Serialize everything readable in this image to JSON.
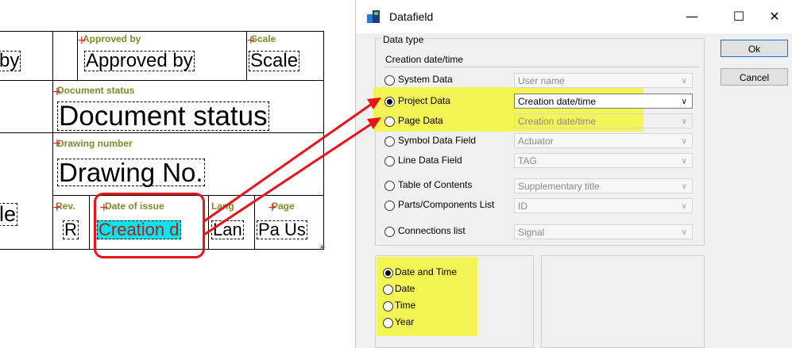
{
  "title_block": {
    "approved_by_label": "Approved by",
    "approved_by_value": "Approved by",
    "scale_label": "Scale",
    "scale_value": "Scale",
    "by_fragment": "by",
    "doc_status_label": "Document status",
    "doc_status_value": "Document status",
    "drawing_number_label": "Drawing number",
    "drawing_number_value": "Drawing No.",
    "le_fragment": "le",
    "rev_label": "Rev.",
    "rev_value": "R",
    "date_issue_label": "Date of issue",
    "date_issue_value": "Creation d",
    "lang_label": "Lang",
    "lang_value": "Lan",
    "page_label": "Page",
    "page_value": "Pa Us"
  },
  "dialog": {
    "title": "Datafield",
    "minimize": "—",
    "maximize": "☐",
    "close": "✕",
    "group_label": "Data type",
    "current_type": "Creation date/time",
    "ok_label": "Ok",
    "cancel_label": "Cancel",
    "rows": [
      {
        "label": "System Data",
        "value": "User name",
        "selected": false,
        "active": false
      },
      {
        "label": "Project Data",
        "value": "Creation date/time",
        "selected": true,
        "active": true
      },
      {
        "label": "Page Data",
        "value": "Creation date/time",
        "selected": false,
        "active": false
      },
      {
        "label": "Symbol Data Field",
        "value": "Actuator",
        "selected": false,
        "active": false
      },
      {
        "label": "Line Data Field",
        "value": "TAG",
        "selected": false,
        "active": false
      },
      {
        "label": "Table of Contents",
        "value": "Supplementary title",
        "selected": false,
        "active": false
      },
      {
        "label": "Parts/Components List",
        "value": "ID",
        "selected": false,
        "active": false
      },
      {
        "label": "Connections list",
        "value": "Signal",
        "selected": false,
        "active": false
      }
    ],
    "formats": [
      {
        "label": "Date and Time",
        "selected": true
      },
      {
        "label": "Date",
        "selected": false
      },
      {
        "label": "Time",
        "selected": false
      },
      {
        "label": "Year",
        "selected": false
      }
    ]
  },
  "colors": {
    "highlight": "#f5f53a",
    "arrow": "#e8141c",
    "selection_bg": "#00e5ee",
    "label_green": "#7c8a2a"
  }
}
